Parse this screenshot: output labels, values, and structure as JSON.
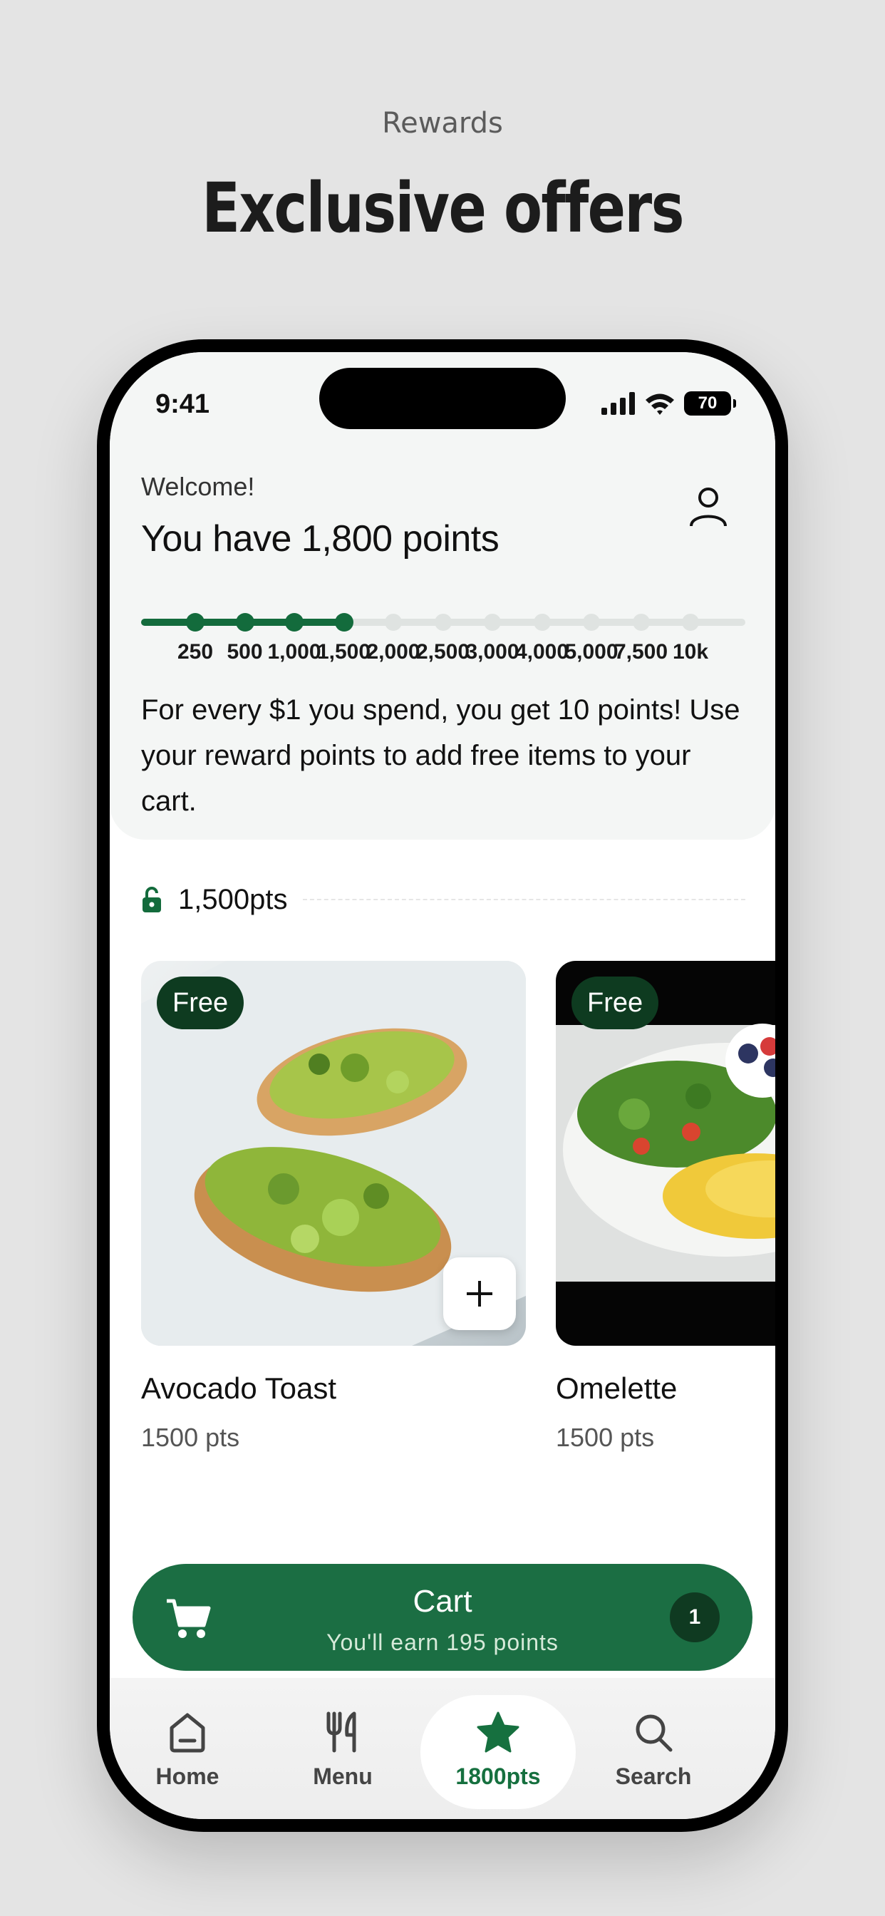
{
  "page": {
    "subtitle": "Rewards",
    "title": "Exclusive offers"
  },
  "status_bar": {
    "time": "9:41",
    "battery": "70"
  },
  "header": {
    "welcome": "Welcome!",
    "points_title": "You have 1,800 points",
    "profile_icon": "user-icon"
  },
  "progress": {
    "current_points": 1800,
    "ticks": [
      "250",
      "500",
      "1,000",
      "1,500",
      "2,000",
      "2,500",
      "3,000",
      "4,000",
      "5,000",
      "7,500",
      "10k"
    ],
    "achieved_count": 4
  },
  "info": {
    "text": "For every $1 you spend, you get 10 points! Use your reward points to add free items to your cart."
  },
  "section": {
    "icon": "unlock-icon",
    "label": "1,500pts"
  },
  "items": [
    {
      "badge": "Free",
      "name": "Avocado Toast",
      "points": "1500 pts"
    },
    {
      "badge": "Free",
      "name": "Omelette",
      "points": "1500 pts"
    }
  ],
  "cart": {
    "title": "Cart",
    "subtitle": "You'll earn 195 points",
    "count": "1"
  },
  "tabs": [
    {
      "label": "Home",
      "icon": "home-icon"
    },
    {
      "label": "Menu",
      "icon": "fork-knife-icon"
    },
    {
      "label": "1800pts",
      "icon": "star-icon",
      "active": true
    },
    {
      "label": "Search",
      "icon": "search-icon"
    }
  ],
  "colors": {
    "brand_green": "#1b6e43",
    "dark_green": "#0e3b20",
    "background": "#e4e4e4"
  }
}
